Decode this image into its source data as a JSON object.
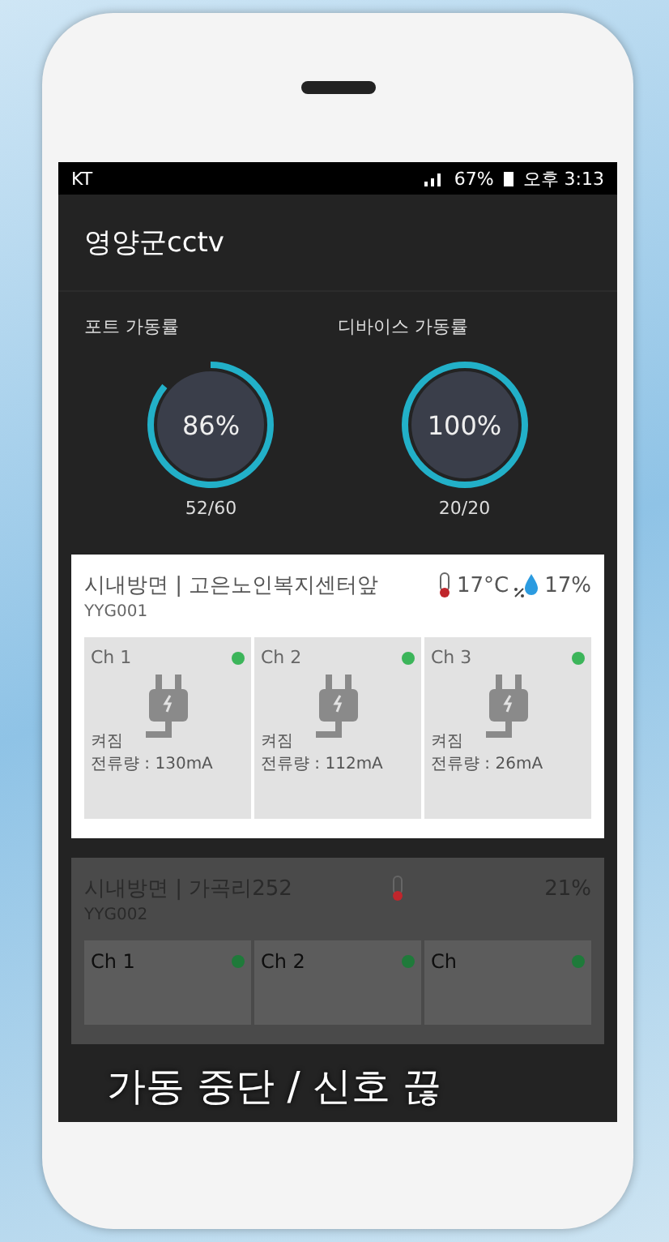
{
  "status_bar": {
    "carrier": "KT",
    "battery": "67%",
    "time": "오후 3:13"
  },
  "app_bar": {
    "title": "영양군cctv"
  },
  "gauges": [
    {
      "label": "포트 가동률",
      "value": "86%",
      "level": 0.86,
      "count": "52/60"
    },
    {
      "label": "디바이스 가동률",
      "value": "100%",
      "level": 1,
      "count": "20/20"
    }
  ],
  "sites": [
    {
      "title": "시내방면 | 고은노인복지센터앞",
      "code": "YYG001",
      "temperature": "17°C",
      "humidity": "17%",
      "dimmed": false,
      "channels": [
        {
          "name": "Ch 1",
          "color": "#3cb55a",
          "state": "켜짐",
          "current": "전류량 : 130mA"
        },
        {
          "name": "Ch 2",
          "color": "#3cb55a",
          "state": "켜짐",
          "current": "전류량 : 112mA"
        },
        {
          "name": "Ch 3",
          "color": "#3cb55a",
          "state": "켜짐",
          "current": "전류량 : 26mA"
        }
      ]
    },
    {
      "title": "시내방면 | 가곡리252",
      "code": "YYG002",
      "humidity": "21%",
      "dimmed": true,
      "channels": [
        {
          "name": "Ch 1",
          "color": "#1f7a3a"
        },
        {
          "name": "Ch 2",
          "color": "#1f7a3a"
        },
        {
          "name": "Ch",
          "color": "#1f7a3a"
        }
      ]
    }
  ],
  "caption": "가동 중단 / 신호 끊"
}
